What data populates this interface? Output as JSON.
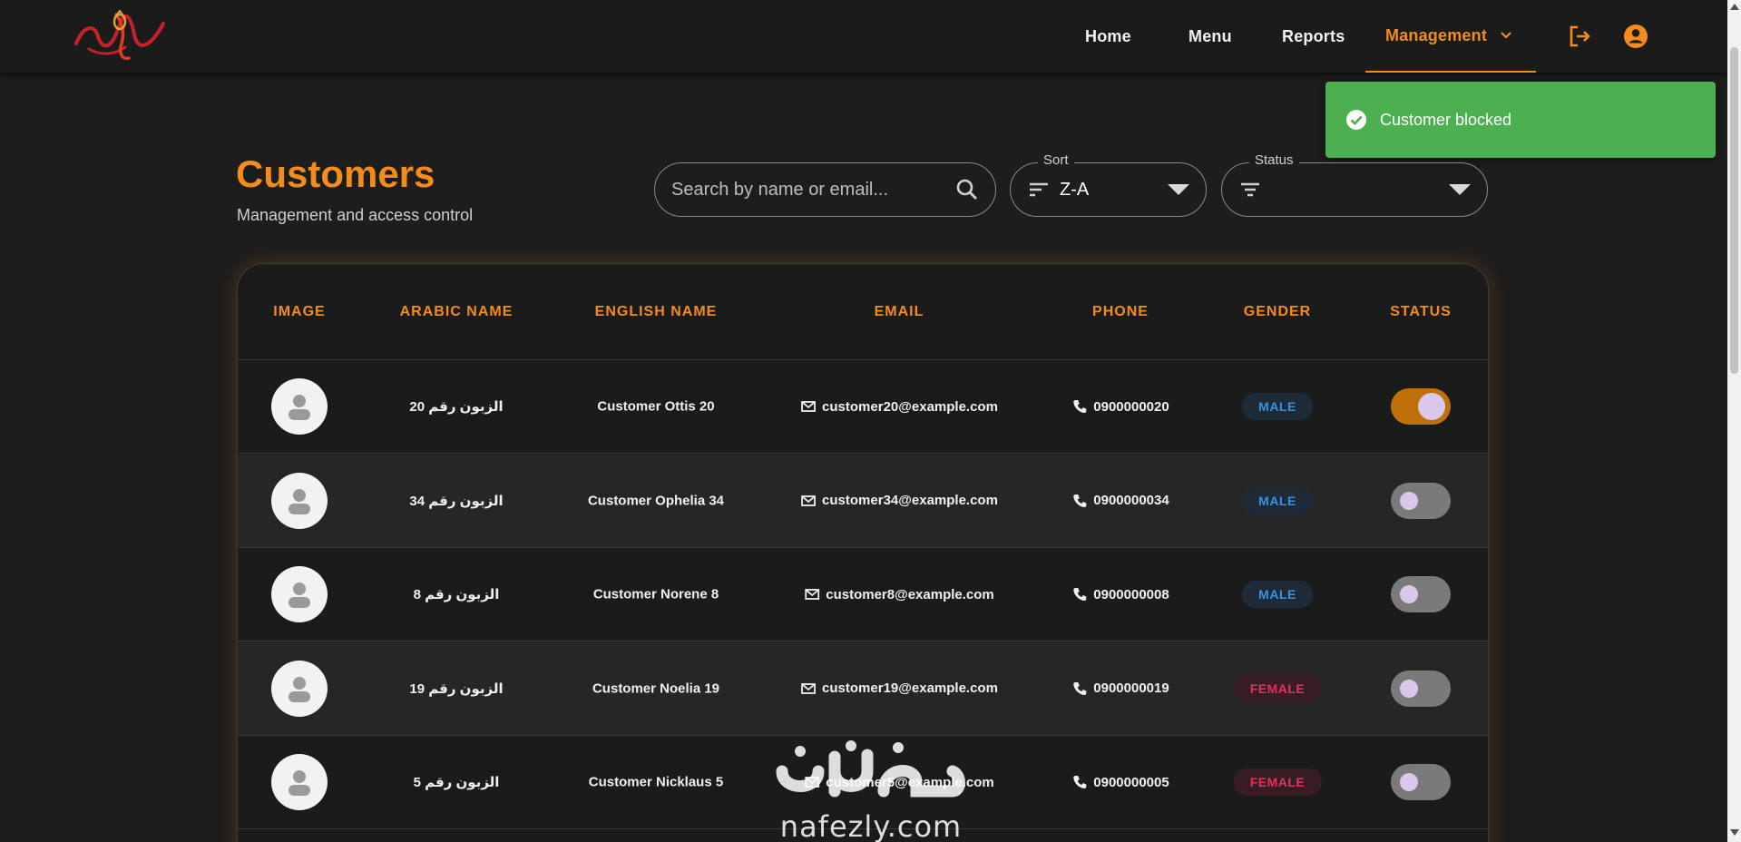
{
  "nav": {
    "logo_icon": "restaurant-logo",
    "items": [
      {
        "label": "Home"
      },
      {
        "label": "Menu"
      },
      {
        "label": "Reports"
      },
      {
        "label": "Management"
      }
    ],
    "active": "Management",
    "icons": [
      "logout-icon",
      "account-circle-icon"
    ]
  },
  "toast": {
    "message": "Customer blocked",
    "icon": "check-circle-icon",
    "color": "#4caf50"
  },
  "page": {
    "title": "Customers",
    "subtitle": "Management and access control"
  },
  "search": {
    "placeholder": "Search by name or email...",
    "value": ""
  },
  "sort": {
    "label": "Sort",
    "value": "Z-A"
  },
  "status_filter": {
    "label": "Status",
    "value": ""
  },
  "table": {
    "columns": [
      "IMAGE",
      "ARABIC NAME",
      "ENGLISH NAME",
      "EMAIL",
      "PHONE",
      "GENDER",
      "STATUS"
    ],
    "rows": [
      {
        "arabic_name": "الزبون رقم 20",
        "english_name": "Customer Ottis 20",
        "email": "customer20@example.com",
        "phone": "0900000020",
        "gender": "MALE",
        "status_on": true
      },
      {
        "arabic_name": "الزبون رقم 34",
        "english_name": "Customer Ophelia 34",
        "email": "customer34@example.com",
        "phone": "0900000034",
        "gender": "MALE",
        "status_on": false
      },
      {
        "arabic_name": "الزبون رقم 8",
        "english_name": "Customer Norene 8",
        "email": "customer8@example.com",
        "phone": "0900000008",
        "gender": "MALE",
        "status_on": false
      },
      {
        "arabic_name": "الزبون رقم 19",
        "english_name": "Customer Noelia 19",
        "email": "customer19@example.com",
        "phone": "0900000019",
        "gender": "FEMALE",
        "status_on": false
      },
      {
        "arabic_name": "الزبون رقم 5",
        "english_name": "Customer Nicklaus 5",
        "email": "customer5@example.com",
        "phone": "0900000005",
        "gender": "FEMALE",
        "status_on": false
      }
    ]
  },
  "watermark": {
    "arabic": "نفذلي",
    "latin": "nafezly.com"
  },
  "colors": {
    "accent": "#f28c1a",
    "background": "#1d1d1d",
    "male_badge": "#3a92dd",
    "female_badge": "#e0335e",
    "toggle_on": "#c0700a"
  }
}
